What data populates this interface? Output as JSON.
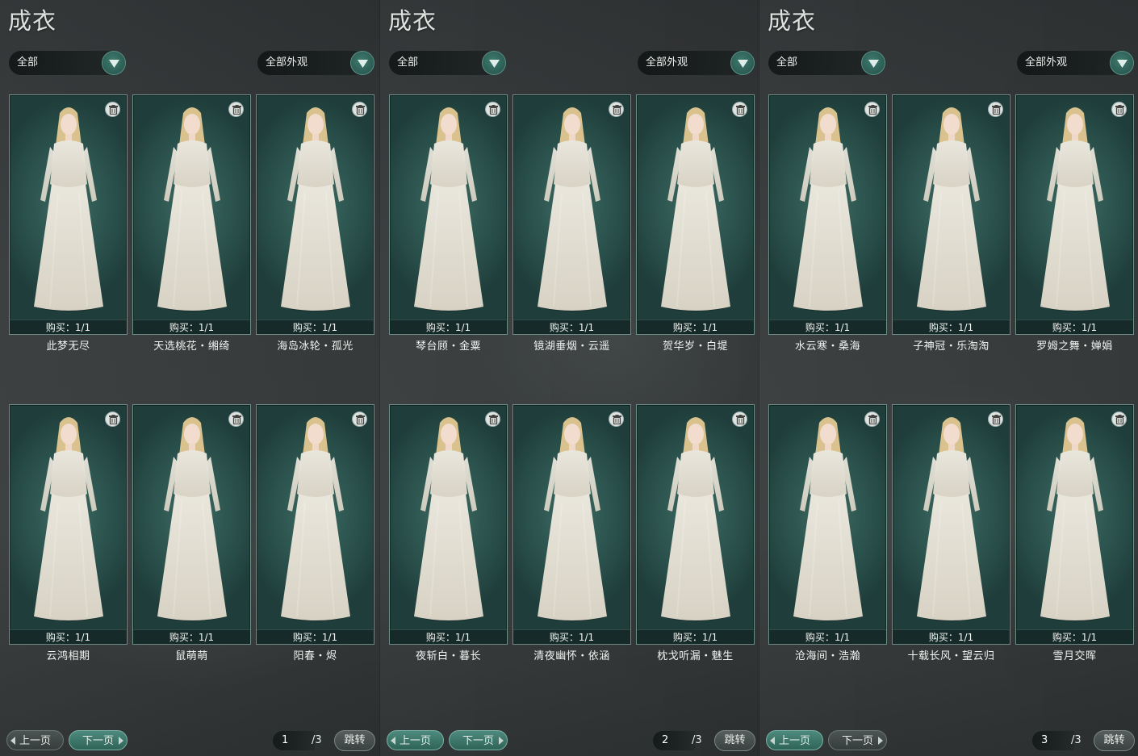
{
  "panels": [
    {
      "title": "成衣",
      "filter1": "全部",
      "filter2": "全部外观",
      "prev_label": "上一页",
      "next_label": "下一页",
      "page": "1",
      "total": "/3",
      "jump_label": "跳转",
      "active_nav": "next",
      "items": [
        {
          "buy": "购买：1/1",
          "name": "此梦无尽",
          "colors": [
            "#e9e6dc",
            "#d7d2c4"
          ]
        },
        {
          "buy": "购买：1/1",
          "name": "天选桃花・缃绮",
          "colors": [
            "#efe3cf",
            "#d9cdb6"
          ]
        },
        {
          "buy": "购买：1/1",
          "name": "海岛冰轮・孤光",
          "colors": [
            "#e6eae8",
            "#cfd7d4"
          ]
        },
        {
          "buy": "购买：1/1",
          "name": "云鸿相期",
          "colors": [
            "#3b2a22",
            "#c9b8b8"
          ]
        },
        {
          "buy": "购买：1/1",
          "name": "鼠萌萌",
          "colors": [
            "#3ea845",
            "#7a5030"
          ]
        },
        {
          "buy": "购买：1/1",
          "name": "阳春・烬",
          "colors": [
            "#e8e4d6",
            "#9a2a22"
          ]
        }
      ]
    },
    {
      "title": "成衣",
      "filter1": "全部",
      "filter2": "全部外观",
      "prev_label": "上一页",
      "next_label": "下一页",
      "page": "2",
      "total": "/3",
      "jump_label": "跳转",
      "active_nav": "both",
      "items": [
        {
          "buy": "购买：1/1",
          "name": "琴台顾・金粟",
          "colors": [
            "#a31520",
            "#6e0c14"
          ]
        },
        {
          "buy": "购买：1/1",
          "name": "镜湖垂烟・云遥",
          "colors": [
            "#a9c9e0",
            "#d8e6ee"
          ]
        },
        {
          "buy": "购买：1/1",
          "name": "贺华岁・白堤",
          "colors": [
            "#eceeee",
            "#d6dada"
          ]
        },
        {
          "buy": "购买：1/1",
          "name": "夜斩白・暮长",
          "colors": [
            "#7c1a1c",
            "#2a1e1e"
          ]
        },
        {
          "buy": "购买：1/1",
          "name": "清夜幽怀・依涵",
          "colors": [
            "#e9a59a",
            "#f2c1b6"
          ]
        },
        {
          "buy": "购买：1/1",
          "name": "枕戈听漏・魅生",
          "colors": [
            "#1b1b1d",
            "#3a3434"
          ]
        }
      ]
    },
    {
      "title": "成衣",
      "filter1": "全部",
      "filter2": "全部外观",
      "prev_label": "上一页",
      "next_label": "下一页",
      "page": "3",
      "total": "/3",
      "jump_label": "跳转",
      "active_nav": "prev",
      "items": [
        {
          "buy": "购买：1/1",
          "name": "水云寒・桑海",
          "colors": [
            "#bfe6ea",
            "#e2f1f1"
          ]
        },
        {
          "buy": "购买：1/1",
          "name": "子神冠・乐淘淘",
          "colors": [
            "#3aa653",
            "#7a5030"
          ]
        },
        {
          "buy": "购买：1/1",
          "name": "罗姆之舞・婵娟",
          "colors": [
            "#f0d3c4",
            "#e5c6b5"
          ]
        },
        {
          "buy": "购买：1/1",
          "name": "沧海间・浩瀚",
          "colors": [
            "#e6eef0",
            "#cfdcdf"
          ]
        },
        {
          "buy": "购买：1/1",
          "name": "十载长风・望云归",
          "colors": [
            "#1d1a1b",
            "#6c1a1c"
          ]
        },
        {
          "buy": "购买：1/1",
          "name": "雪月交晖",
          "colors": [
            "#3f8fc6",
            "#e8eef0"
          ]
        }
      ]
    }
  ]
}
